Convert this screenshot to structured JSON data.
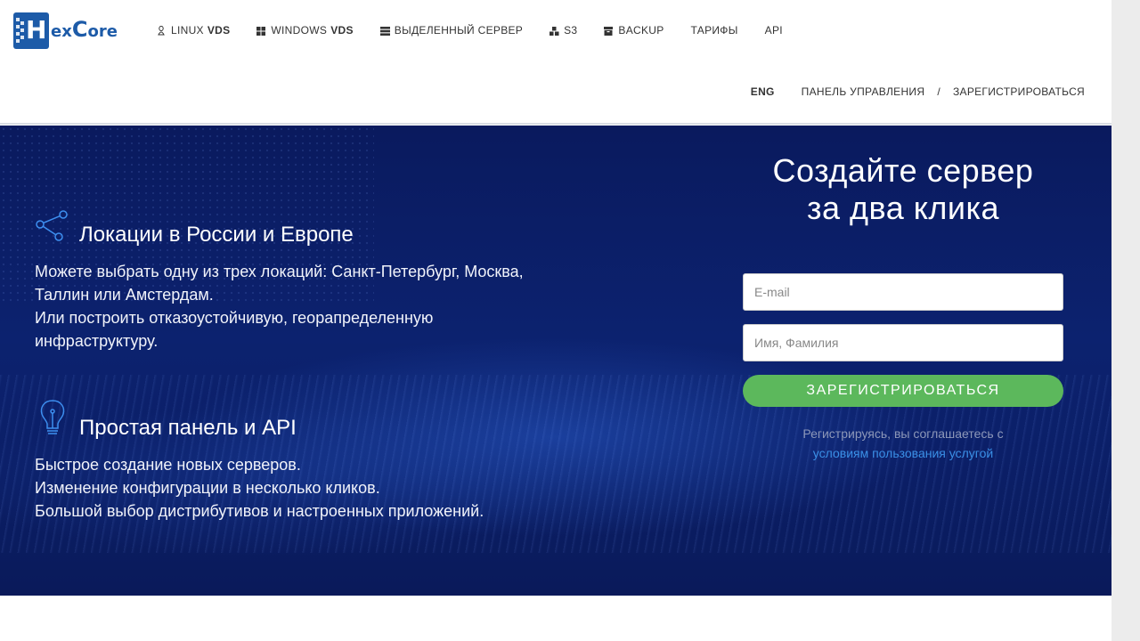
{
  "header": {
    "logo": {
      "letter": "H",
      "text_part1": "ex",
      "text_part2": "C",
      "text_part3": "ore"
    },
    "nav": [
      {
        "icon": "linux-icon",
        "label": "Linux",
        "bold": "VDS"
      },
      {
        "icon": "windows-icon",
        "label": "Windows",
        "bold": "VDS"
      },
      {
        "icon": "server-icon",
        "label": "Выделенный сервер",
        "bold": ""
      },
      {
        "icon": "blocks-icon",
        "label": "S3",
        "bold": ""
      },
      {
        "icon": "box-icon",
        "label": "Backup",
        "bold": ""
      },
      {
        "icon": "",
        "label": "Тарифы",
        "bold": ""
      },
      {
        "icon": "",
        "label": "API",
        "bold": ""
      }
    ],
    "subnav": {
      "lang": "ENG",
      "panel": "ПАНЕЛЬ УПРАВЛЕНИЯ",
      "separator": "/",
      "register": "ЗАРЕГИСТРИРОВАТЬСЯ"
    }
  },
  "features": [
    {
      "icon": "share-icon",
      "title": "Локации в России и Европе",
      "lines": [
        "Можете выбрать одну из трех локаций: Санкт-Петербург, Москва,",
        "Таллин или Амстердам.",
        "Или построить отказоустойчивую, георапределенную",
        "инфраструктуру."
      ]
    },
    {
      "icon": "lightbulb-icon",
      "title": "Простая панель и API",
      "lines": [
        "Быстрое создание новых серверов.",
        "Изменение конфигурации в несколько кликов.",
        "Большой выбор дистрибутивов и настроенных приложений."
      ]
    }
  ],
  "signup": {
    "title_line1": "Создайте сервер",
    "title_line2": "за два клика",
    "email_placeholder": "E-mail",
    "name_placeholder": "Имя, Фамилия",
    "button": "Зарегистрироваться",
    "terms_text": "Регистрируясь, вы соглашаетесь с",
    "terms_link": "условиям пользования услугой"
  },
  "colors": {
    "brand": "#1d5ba8",
    "hero_bg": "#0c226f",
    "button_green": "#5cb85c",
    "link_blue": "#3a8fe6"
  }
}
